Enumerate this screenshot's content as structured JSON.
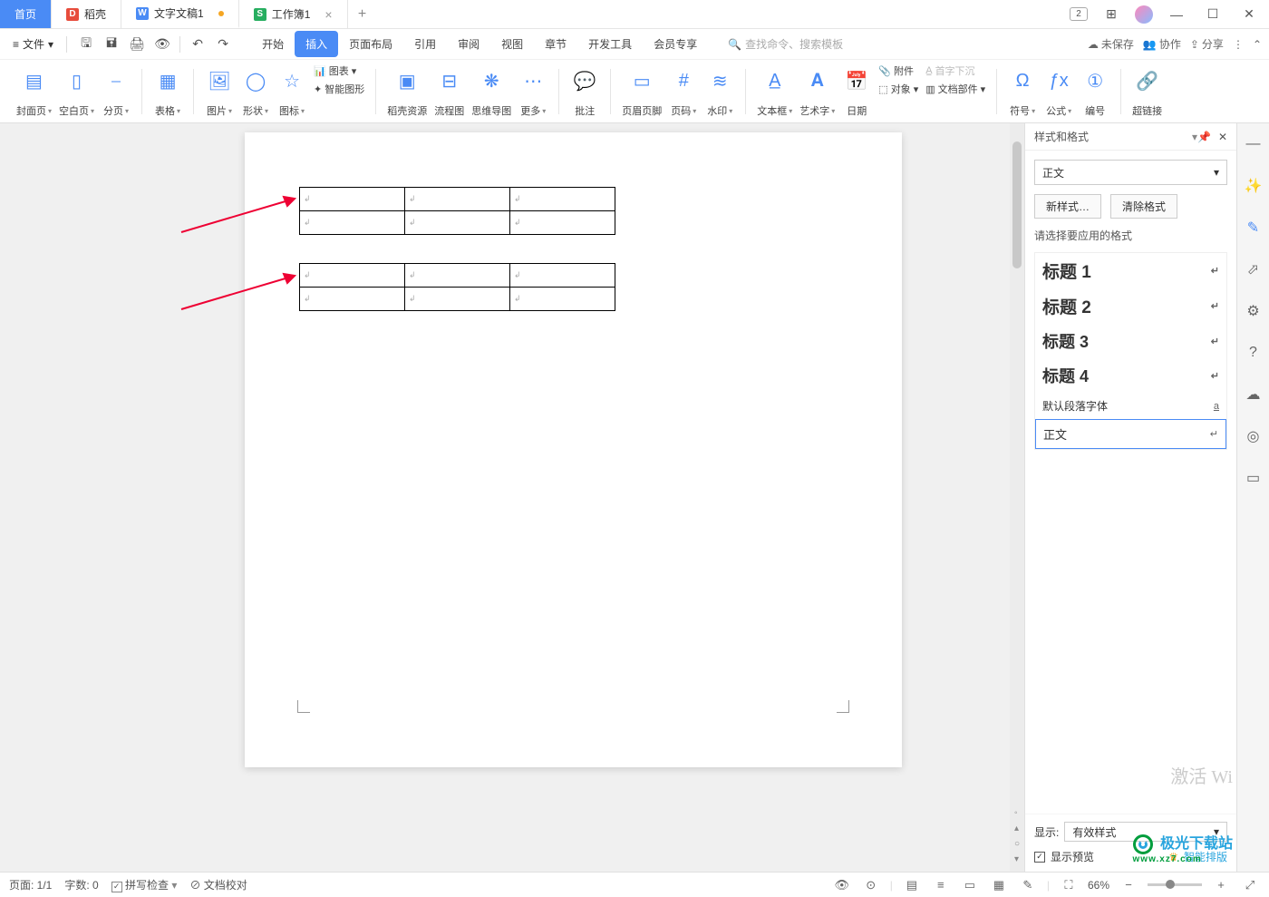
{
  "tabs": {
    "home": "首页",
    "dk": "稻壳",
    "doc": "文字文稿1",
    "sheet": "工作簿1"
  },
  "title_right": {
    "badge": "2"
  },
  "menu": {
    "file": "文件",
    "items": [
      "开始",
      "插入",
      "页面布局",
      "引用",
      "审阅",
      "视图",
      "章节",
      "开发工具",
      "会员专享"
    ],
    "search_ph": "查找命令、搜索模板",
    "unsaved": "未保存",
    "collab": "协作",
    "share": "分享"
  },
  "ribbon": {
    "cover": "封面页",
    "blank": "空白页",
    "pagebreak": "分页",
    "table": "表格",
    "picture": "图片",
    "shape": "形状",
    "iconlib": "图标",
    "chart": "图表",
    "smart": "智能图形",
    "res": "稻壳资源",
    "flow": "流程图",
    "mind": "思维导图",
    "more": "更多",
    "comment": "批注",
    "headerfooter": "页眉页脚",
    "pagenum": "页码",
    "watermark": "水印",
    "textbox": "文本框",
    "wordart": "艺术字",
    "date": "日期",
    "attach": "附件",
    "object": "对象",
    "dropcap": "首字下沉",
    "docpart": "文档部件",
    "symbol": "符号",
    "formula": "公式",
    "numbering": "编号",
    "hyperlink": "超链接"
  },
  "panel": {
    "title": "样式和格式",
    "current": "正文",
    "new_style": "新样式…",
    "clear": "清除格式",
    "prompt": "请选择要应用的格式",
    "styles": [
      {
        "name": "标题 1",
        "cls": "h1"
      },
      {
        "name": "标题 2",
        "cls": "h2"
      },
      {
        "name": "标题 3",
        "cls": "h3"
      },
      {
        "name": "标题 4",
        "cls": "h4"
      },
      {
        "name": "默认段落字体",
        "cls": "df",
        "mark": "a"
      },
      {
        "name": "正文",
        "cls": "body-sel"
      }
    ],
    "show": "显示:",
    "show_val": "有效样式",
    "preview": "显示预览",
    "smart_layout": "智能排版"
  },
  "status": {
    "page": "页面: 1/1",
    "words": "字数: 0",
    "spell": "拼写检查",
    "proof": "文档校对",
    "zoom": "66%"
  },
  "watermark": "激活 Wi",
  "logo": {
    "main": "极光下载站",
    "sub": "www.xz7.com"
  }
}
